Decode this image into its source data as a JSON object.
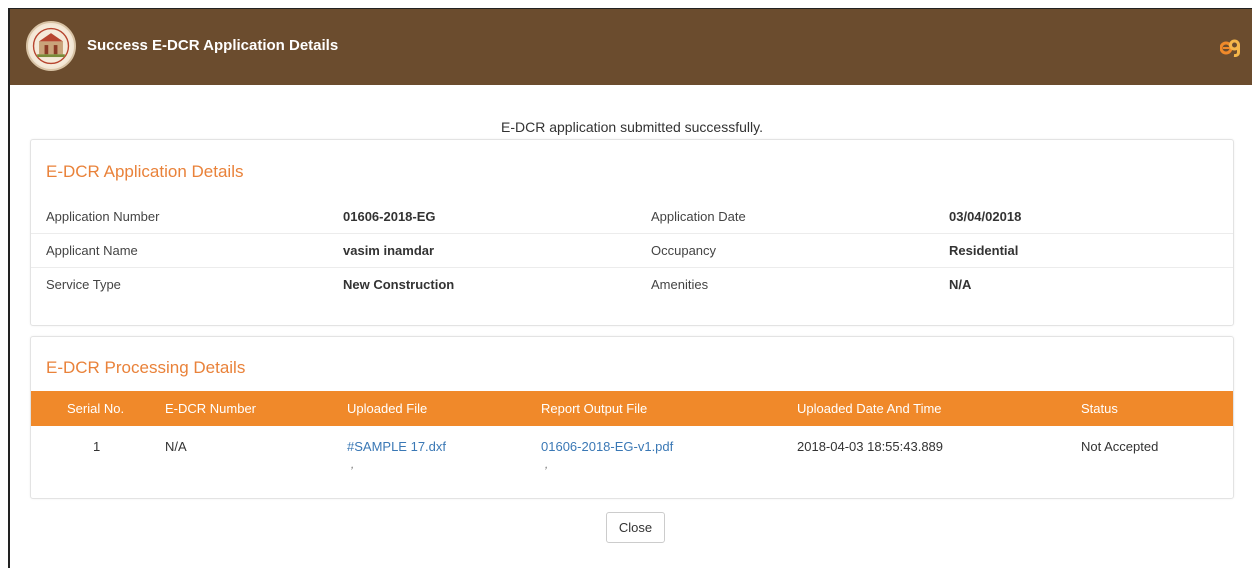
{
  "header": {
    "title": "Success E-DCR Application Details",
    "logo_icon": "municipal-seal-logo",
    "brand_icon": "e9-brand-icon",
    "bar_color": "#6b4c2e"
  },
  "message": "E-DCR application submitted successfully.",
  "application_details": {
    "title": "E-DCR Application Details",
    "rows": [
      {
        "label1": "Application Number",
        "value1": "01606-2018-EG",
        "label2": "Application Date",
        "value2": "03/04/02018"
      },
      {
        "label1": "Applicant Name",
        "value1": "vasim inamdar",
        "label2": "Occupancy",
        "value2": "Residential"
      },
      {
        "label1": "Service Type",
        "value1": "New Construction",
        "label2": "Amenities",
        "value2": "N/A"
      }
    ]
  },
  "processing_details": {
    "title": "E-DCR Processing Details",
    "header_color": "#f0892a",
    "columns": [
      "Serial No.",
      "E-DCR Number",
      "Uploaded File",
      "Report Output File",
      "Uploaded Date And Time",
      "Status"
    ],
    "rows": [
      {
        "serial": "1",
        "edcr_number": "N/A",
        "uploaded_file": "#SAMPLE 17.dxf",
        "report_file": "01606-2018-EG-v1.pdf",
        "uploaded_at": "2018-04-03 18:55:43.889",
        "status": "Not Accepted"
      }
    ]
  },
  "footer": {
    "close_label": "Close"
  }
}
